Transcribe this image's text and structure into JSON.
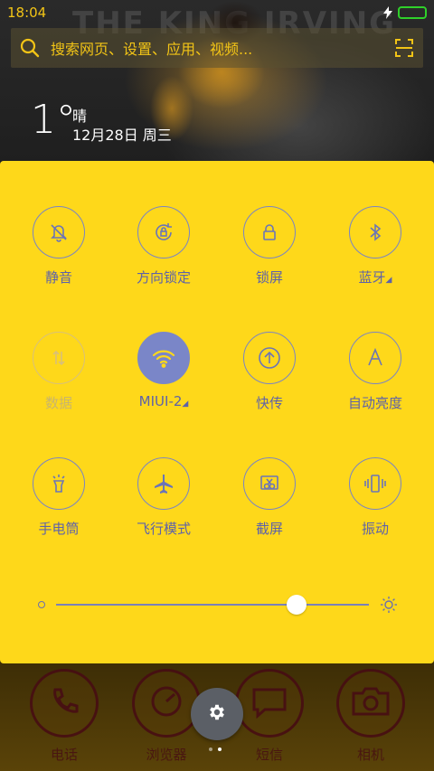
{
  "status_bar": {
    "time": "18:04"
  },
  "search": {
    "placeholder": "搜索网页、设置、应用、视频..."
  },
  "weather": {
    "temp": "1°",
    "condition": "晴",
    "date": "12月28日 周三"
  },
  "wallpaper": {
    "ghost_text": "THE KING IRVING"
  },
  "colors": {
    "panel": "#fed81a",
    "accent": "#7a86c8",
    "label": "#5e62a8",
    "status_time": "#f2c416",
    "battery": "#2fd12a"
  },
  "tiles": [
    {
      "label": "静音",
      "icon": "bell-off-icon",
      "state": "off"
    },
    {
      "label": "方向锁定",
      "icon": "rotation-lock-icon",
      "state": "off"
    },
    {
      "label": "锁屏",
      "icon": "lock-icon",
      "state": "off"
    },
    {
      "label": "蓝牙",
      "icon": "bluetooth-icon",
      "state": "off",
      "expandable": true
    },
    {
      "label": "数据",
      "icon": "mobile-data-icon",
      "state": "disabled"
    },
    {
      "label": "MIUI-2",
      "icon": "wifi-icon",
      "state": "on",
      "expandable": true
    },
    {
      "label": "快传",
      "icon": "quick-share-icon",
      "state": "off"
    },
    {
      "label": "自动亮度",
      "icon": "auto-brightness-icon",
      "state": "off"
    },
    {
      "label": "手电筒",
      "icon": "flashlight-icon",
      "state": "off"
    },
    {
      "label": "飞行模式",
      "icon": "airplane-icon",
      "state": "off"
    },
    {
      "label": "截屏",
      "icon": "screenshot-icon",
      "state": "off"
    },
    {
      "label": "振动",
      "icon": "vibrate-icon",
      "state": "off"
    }
  ],
  "brightness": {
    "level_percent": 77
  },
  "dock": [
    {
      "label": "电话",
      "icon": "phone-icon"
    },
    {
      "label": "浏览器",
      "icon": "compass-icon"
    },
    {
      "label": "短信",
      "icon": "message-icon"
    },
    {
      "label": "相机",
      "icon": "camera-icon"
    }
  ],
  "pager": {
    "current": 2,
    "total": 2
  }
}
